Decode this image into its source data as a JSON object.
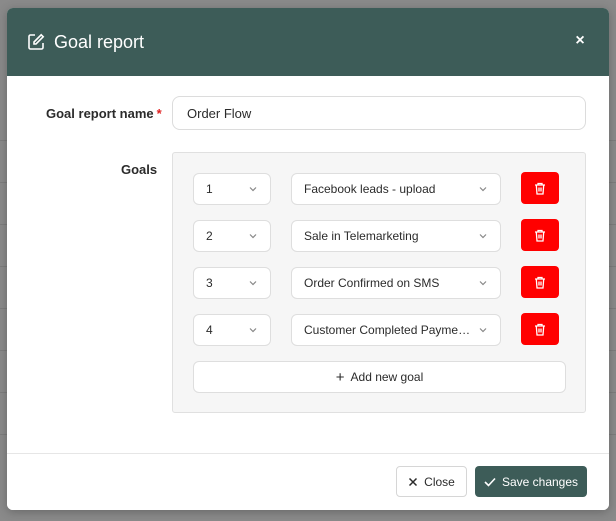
{
  "modal": {
    "title": "Goal report",
    "close_glyph": "×"
  },
  "form": {
    "name_label": "Goal report name",
    "required_mark": "*",
    "name_value": "Order Flow",
    "goals_label": "Goals"
  },
  "goals": [
    {
      "order": "1",
      "goal": "Facebook leads - upload"
    },
    {
      "order": "2",
      "goal": "Sale in Telemarketing"
    },
    {
      "order": "3",
      "goal": "Order Confirmed on SMS"
    },
    {
      "order": "4",
      "goal": "Customer Completed Payment..."
    }
  ],
  "add_goal_label": "Add new goal",
  "footer": {
    "close_label": "Close",
    "save_label": "Save changes"
  },
  "colors": {
    "header": "#3d5c58",
    "delete": "#ff0000",
    "required": "#e02020"
  },
  "icons": {
    "header": "edit-icon",
    "delete": "trash-icon",
    "select": "chevron-down-icon",
    "add": "plus-icon",
    "close": "x-icon",
    "save": "check-icon"
  }
}
